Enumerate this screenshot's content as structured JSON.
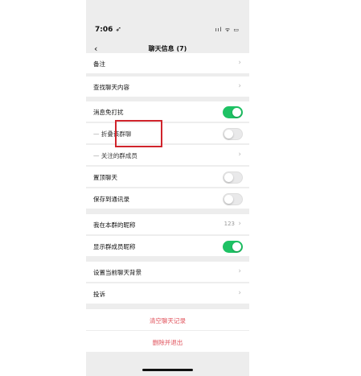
{
  "status": {
    "time": "7:06 ➶",
    "icons": "ııl ᯤ ▭"
  },
  "nav": {
    "back": "‹",
    "title": "聊天信息 (7)"
  },
  "rows": {
    "remark": "备注",
    "search_history": "查找聊天内容",
    "mute": "消息免打扰",
    "fold": "折叠该群聊",
    "followed": "关注的群成员",
    "pin": "置顶聊天",
    "save_contacts": "保存到通讯录",
    "my_alias": "我在本群的昵称",
    "my_alias_value": "123",
    "show_names": "显示群成员昵称",
    "background": "设置当前聊天背景",
    "report": "投诉"
  },
  "toggles": {
    "mute": true,
    "fold": false,
    "pin": false,
    "save_contacts": false,
    "show_names": true
  },
  "actions": {
    "clear": "清空聊天记录",
    "leave": "删除并退出"
  },
  "chevron": "›",
  "colors": {
    "accent_green": "#1ec264",
    "danger_red": "#e0505a",
    "highlight_box": "#d0242c"
  }
}
